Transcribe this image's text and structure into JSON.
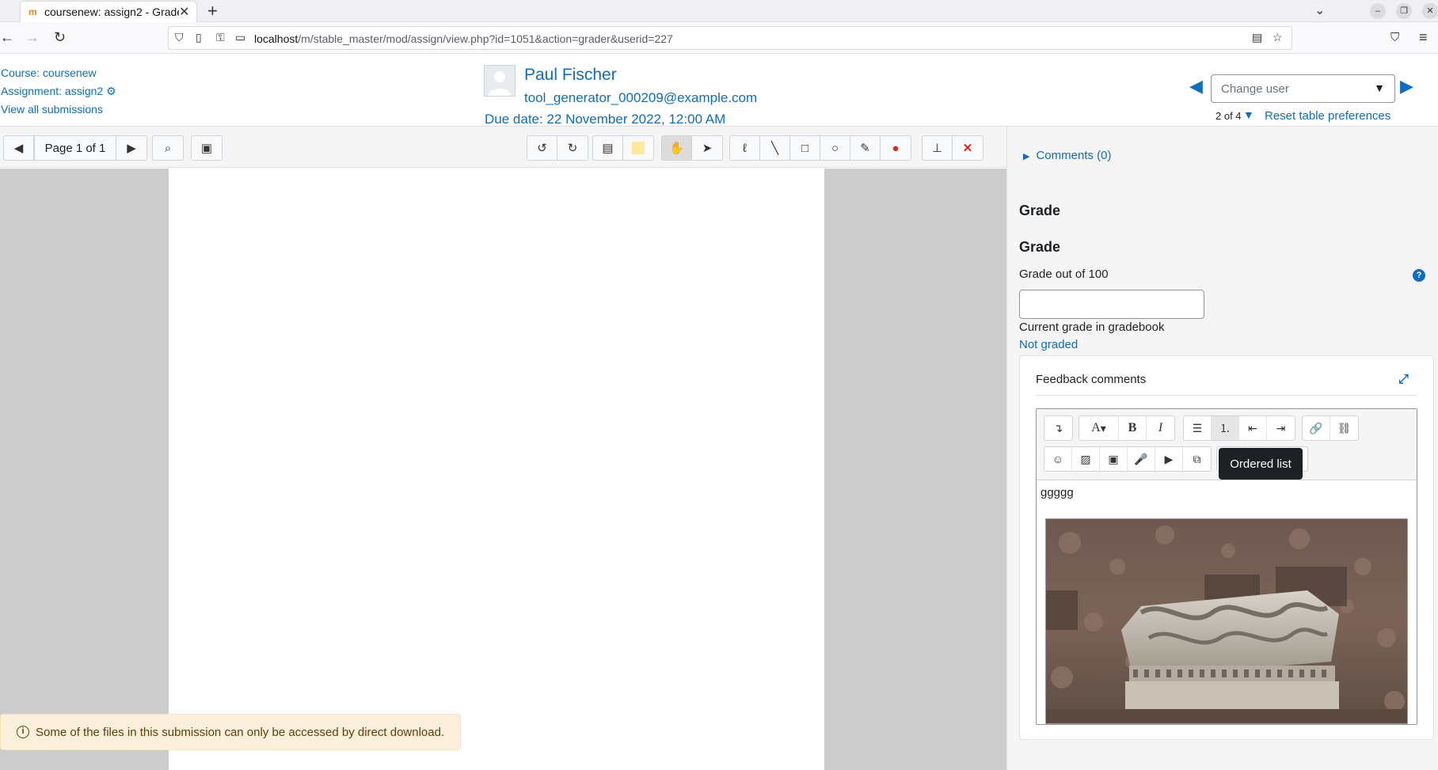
{
  "browser": {
    "tab_title": "coursenew: assign2 - Grader",
    "url_host": "localhost",
    "url_path": "/m/stable_master/mod/assign/view.php?id=1051&action=grader&userid=227"
  },
  "header": {
    "course_link": "Course: coursenew",
    "assignment_link": "Assignment: assign2",
    "view_all_link": "View all submissions",
    "user_name": "Paul Fischer",
    "user_email": "tool_generator_000209@example.com",
    "due_date": "Due date: 22 November 2022, 12:00 AM",
    "change_user_placeholder": "Change user",
    "user_count": "2 of 4",
    "reset_link": "Reset table preferences"
  },
  "pdf_toolbar": {
    "page_label": "Page 1 of 1"
  },
  "notice": {
    "text": "Some of the files in this submission can only be accessed by direct download."
  },
  "panel": {
    "comments_link": "Comments (0)",
    "grade_heading_1": "Grade",
    "grade_heading_2": "Grade",
    "grade_label": "Grade out of 100",
    "grade_value": "",
    "current_grade_label": "Current grade in gradebook",
    "current_grade_value": "Not graded",
    "feedback_title": "Feedback comments",
    "editor_text": "ggggg",
    "tooltip": "Ordered list"
  },
  "colors": {
    "link": "#0f6cbf",
    "notice_bg": "#fcefdc",
    "delete_red": "#e0241f"
  }
}
